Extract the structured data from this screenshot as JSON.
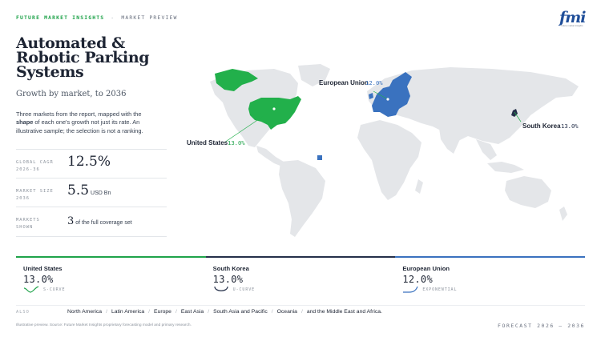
{
  "header": {
    "brand": "FUTURE MARKET INSIGHTS",
    "separator": "-",
    "section": "MARKET PREVIEW"
  },
  "logo": {
    "word": "fmi",
    "tagline": "future market insights"
  },
  "title": "Automated & Robotic Parking Systems",
  "subtitle": "Growth by market, to 2036",
  "description": {
    "before": "Three markets from the report, mapped with the ",
    "bold": "shape",
    "after": " of each one's growth not just its rate. An illustrative sample; the selection is not a ranking."
  },
  "stats": [
    {
      "label_line1": "GLOBAL CAGR",
      "label_line2": "2026-36",
      "value": "12.5%",
      "unit": ""
    },
    {
      "label_line1": "MARKET SIZE",
      "label_line2": "2036",
      "value": "5.5",
      "unit": "USD Bn"
    },
    {
      "label_line1": "MARKETS",
      "label_line2": "SHOWN",
      "value": "3",
      "unit": "of the full coverage set"
    }
  ],
  "map": {
    "callouts": [
      {
        "name": "European Union",
        "value": "12.0%"
      },
      {
        "name": "South Korea",
        "value": "13.0%"
      },
      {
        "name": "United States",
        "value": "13.0%"
      }
    ],
    "colors": {
      "land": "#e4e6e9",
      "us": "#22b04b",
      "eu": "#3a72bf",
      "korea": "#25304a",
      "connector": "#22b04b"
    }
  },
  "cards": [
    {
      "name": "United States",
      "value": "13.0%",
      "shape": "S-CURVE",
      "shape_icon": "check-curve-icon",
      "color": "#1fa34a"
    },
    {
      "name": "South Korea",
      "value": "13.0%",
      "shape": "U-CURVE",
      "shape_icon": "u-curve-icon",
      "color": "#25304a"
    },
    {
      "name": "European Union",
      "value": "12.0%",
      "shape": "EXPONENTIAL",
      "shape_icon": "exponential-curve-icon",
      "color": "#3a72bf"
    }
  ],
  "also": {
    "label": "ALSO",
    "items": [
      "North America",
      "Latin America",
      "Europe",
      "East Asia",
      "South Asia and Pacific",
      "Oceania",
      "and the Middle East and Africa."
    ],
    "separator": "/"
  },
  "footer": {
    "note": "Illustrative preview. Source: Future Market Insights proprietary forecasting model and primary research.",
    "forecast": "FORECAST 2026 – 2036"
  }
}
